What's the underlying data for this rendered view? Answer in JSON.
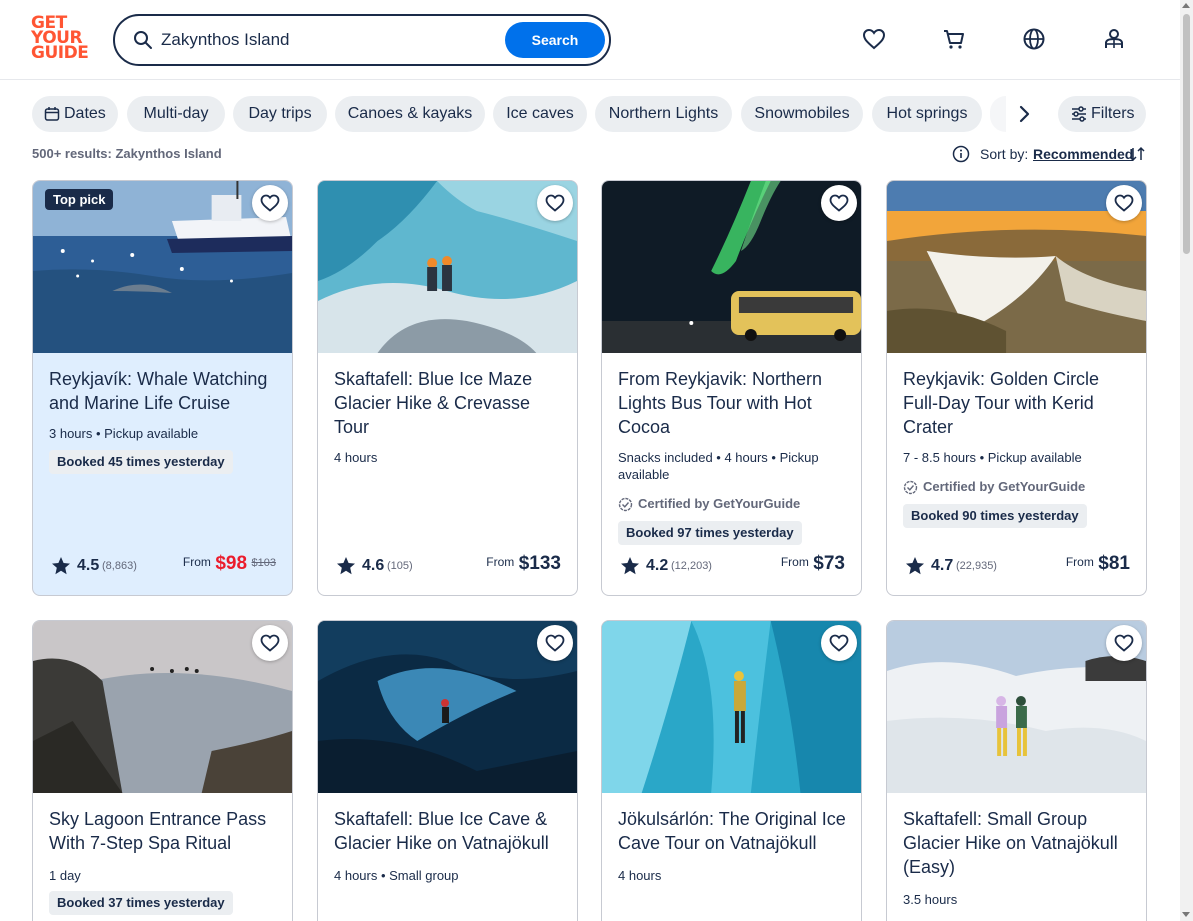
{
  "header": {
    "logo": [
      "GET",
      "YOUR",
      "GUIDE"
    ],
    "search_value": "Zakynthos Island",
    "search_button": "Search",
    "icons": [
      "heart-icon",
      "cart-icon",
      "globe-icon",
      "profile-icon"
    ]
  },
  "chips": [
    {
      "label": "Dates",
      "icon": "calendar-icon"
    },
    {
      "label": "Multi-day"
    },
    {
      "label": "Day trips"
    },
    {
      "label": "Canoes & kayaks"
    },
    {
      "label": "Ice caves"
    },
    {
      "label": "Northern Lights"
    },
    {
      "label": "Snowmobiles"
    },
    {
      "label": "Hot springs"
    }
  ],
  "filters_label": "Filters",
  "results_text": "500+ results: Zakynthos Island",
  "sort": {
    "label": "Sort by:",
    "value": "Recommended"
  },
  "cards": [
    {
      "badge": "Top pick",
      "title": "Reykjavík: Whale Watching and Marine Life Cruise",
      "meta": "3 hours • Pickup available",
      "certified": "",
      "booked": "Booked 45 times yesterday",
      "rating": "4.5",
      "reviews": "(8,863)",
      "from": "From",
      "price": "$98",
      "old_price": "$103",
      "image": "whale-watching-boat"
    },
    {
      "badge": "",
      "title": "Skaftafell: Blue Ice Maze Glacier Hike & Crevasse Tour",
      "meta": "4 hours",
      "certified": "",
      "booked": "",
      "rating": "4.6",
      "reviews": "(105)",
      "from": "From",
      "price": "$133",
      "old_price": "",
      "image": "blue-ice-glacier"
    },
    {
      "badge": "",
      "title": "From Reykjavik: Northern Lights Bus Tour with Hot Cocoa",
      "meta": "Snacks included • 4 hours • Pickup available",
      "certified": "Certified by GetYourGuide",
      "booked": "Booked 97 times yesterday",
      "rating": "4.2",
      "reviews": "(12,203)",
      "from": "From",
      "price": "$73",
      "old_price": "",
      "image": "northern-lights-bus"
    },
    {
      "badge": "",
      "title": "Reykjavik: Golden Circle Full-Day Tour with Kerid Crater",
      "meta": "7 - 8.5 hours • Pickup available",
      "certified": "Certified by GetYourGuide",
      "booked": "Booked 90 times yesterday",
      "rating": "4.7",
      "reviews": "(22,935)",
      "from": "From",
      "price": "$81",
      "old_price": "",
      "image": "waterfall-sunset"
    },
    {
      "title": "Sky Lagoon Entrance Pass With 7-Step Spa Ritual",
      "meta": "1 day",
      "booked": "Booked 37 times yesterday",
      "image": "sky-lagoon"
    },
    {
      "title": "Skaftafell: Blue Ice Cave & Glacier Hike on Vatnajökull",
      "meta": "4 hours • Small group",
      "image": "dark-ice-cave"
    },
    {
      "title": "Jökulsárlón: The Original Ice Cave Tour on Vatnajökull",
      "meta": "4 hours",
      "image": "turquoise-ice-cave"
    },
    {
      "title": "Skaftafell: Small Group Glacier Hike on Vatnajökull (Easy)",
      "meta": "3.5 hours",
      "image": "glacier-hikers"
    }
  ],
  "colors": {
    "brand": "#ff5533",
    "primary": "#0071eb",
    "text": "#1a2b49",
    "sale": "#eb1c2d"
  }
}
